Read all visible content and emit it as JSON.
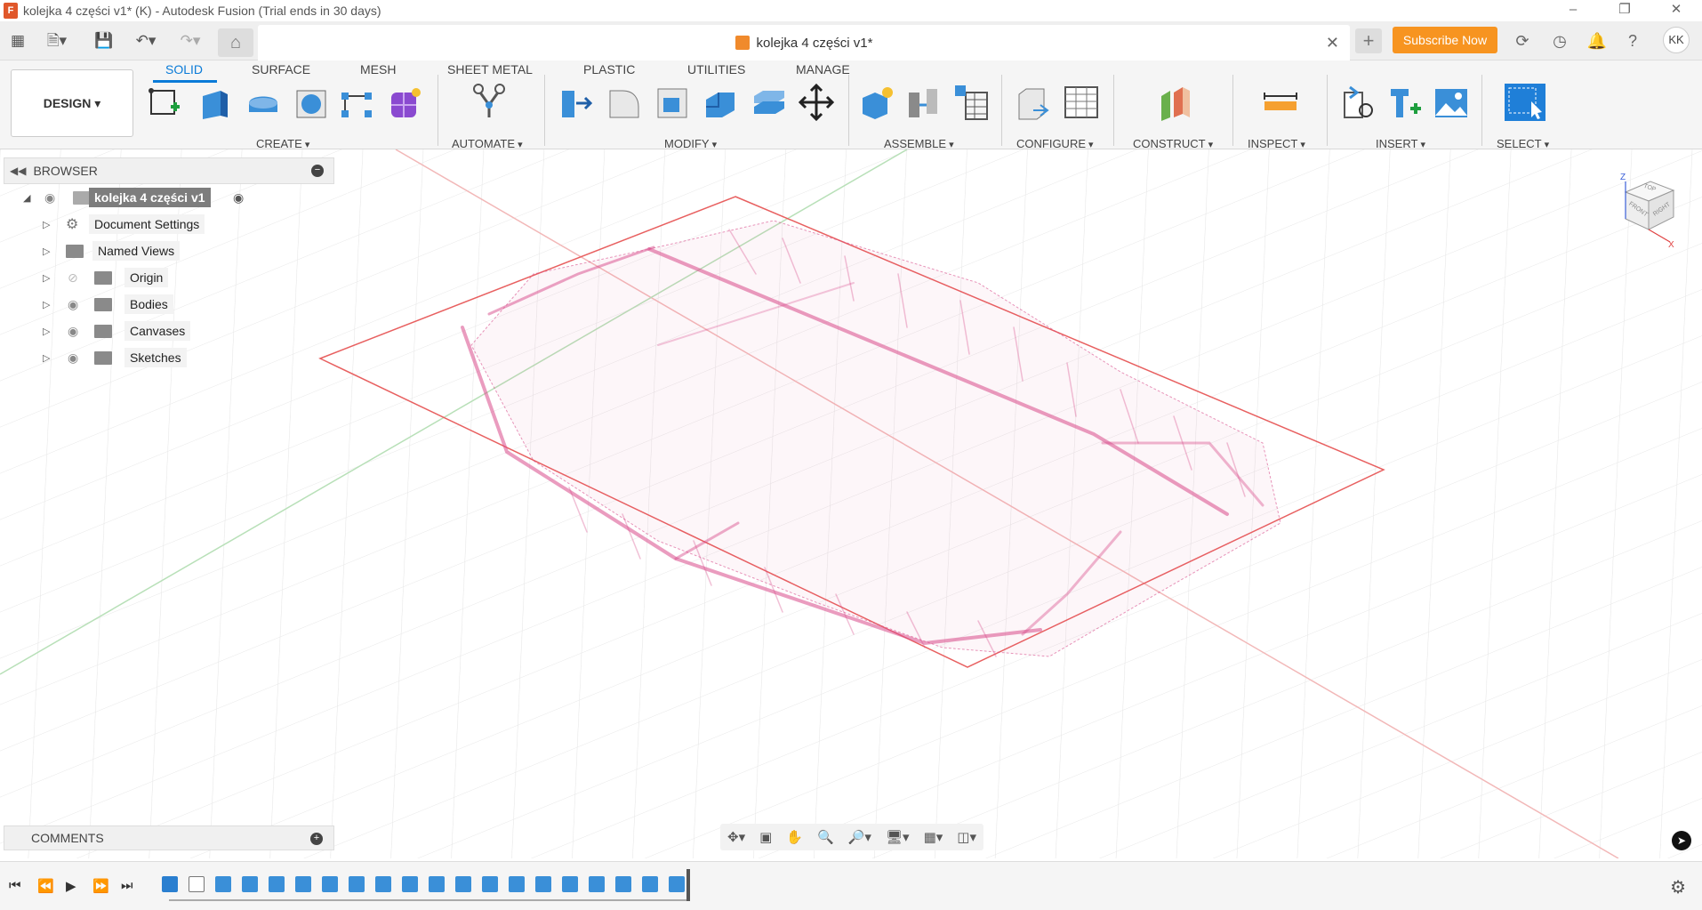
{
  "window": {
    "title": "kolejka 4 części v1* (K) - Autodesk Fusion (Trial ends in 30 days)",
    "min_icon": "minimize-icon",
    "restore_icon": "restore-icon",
    "close_icon": "close-icon"
  },
  "appbar": {
    "doc_tab_label": "kolejka 4 części v1*",
    "subscribe_label": "Subscribe Now",
    "avatar_initials": "KK"
  },
  "ribbon": {
    "workspace_label": "DESIGN ▾",
    "tabs": [
      "SOLID",
      "SURFACE",
      "MESH",
      "SHEET METAL",
      "PLASTIC",
      "UTILITIES",
      "MANAGE"
    ],
    "active_tab": "SOLID",
    "groups": [
      "CREATE",
      "AUTOMATE",
      "MODIFY",
      "ASSEMBLE",
      "CONFIGURE",
      "CONSTRUCT",
      "INSPECT",
      "INSERT",
      "SELECT"
    ]
  },
  "browser": {
    "header": "BROWSER",
    "root_label": "kolejka 4 części v1",
    "items": [
      {
        "label": "Document Settings"
      },
      {
        "label": "Named Views"
      },
      {
        "label": "Origin"
      },
      {
        "label": "Bodies"
      },
      {
        "label": "Canvases"
      },
      {
        "label": "Sketches"
      }
    ]
  },
  "comments": {
    "label": "COMMENTS"
  },
  "viewcube": {
    "top": "TOP",
    "front": "FRONT",
    "right": "RIGHT",
    "z_axis": "Z",
    "x_axis": "X"
  },
  "colors": {
    "accent": "#0a7bd8",
    "subscribe": "#f79420",
    "pointcloud": "#d84a8a",
    "sketch_plane": "#e86060"
  }
}
